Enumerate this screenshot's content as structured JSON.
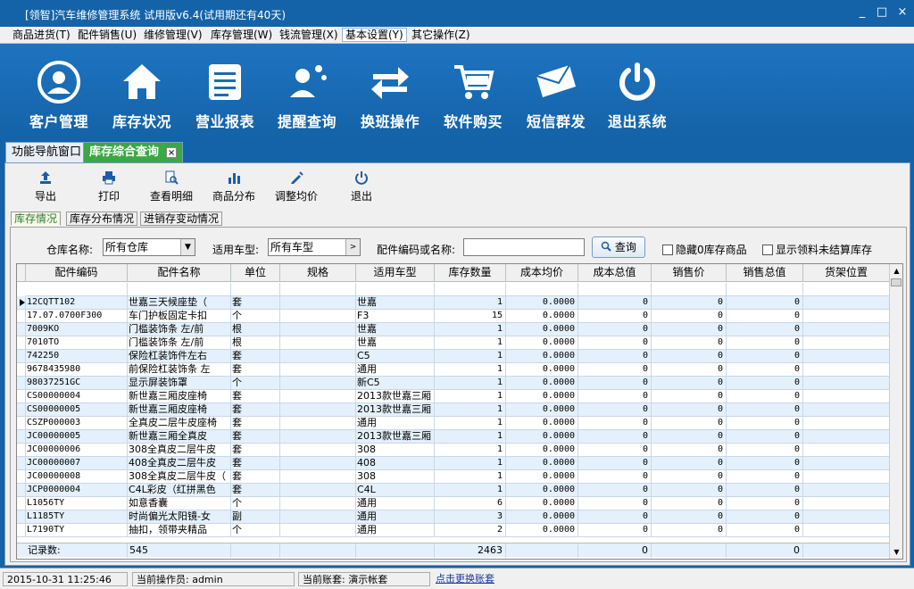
{
  "window": {
    "title": "[领智]汽车维修管理系统 试用版v6.4(试用期还有40天)",
    "controls": [
      "_",
      "□",
      "×"
    ]
  },
  "menu": [
    "商品进货(T)",
    "配件销售(U)",
    "维修管理(V)",
    "库存管理(W)",
    "钱流管理(X)",
    "基本设置(Y)",
    "其它操作(Z)"
  ],
  "big_toolbar": [
    {
      "label": "客户管理",
      "icon": "user-icon"
    },
    {
      "label": "库存状况",
      "icon": "home-icon"
    },
    {
      "label": "营业报表",
      "icon": "report-icon"
    },
    {
      "label": "提醒查询",
      "icon": "reminder-icon"
    },
    {
      "label": "换班操作",
      "icon": "switch-icon"
    },
    {
      "label": "软件购买",
      "icon": "cart-icon"
    },
    {
      "label": "短信群发",
      "icon": "envelope-icon"
    },
    {
      "label": "退出系统",
      "icon": "power-icon"
    }
  ],
  "tabs": {
    "nav": "功能导航窗口",
    "active": "库存综合查询",
    "close": "×"
  },
  "toolbar": {
    "export": "导出",
    "print": "打印",
    "detail": "查看明细",
    "distribution": "商品分布",
    "adjust": "调整均价",
    "exit": "退出"
  },
  "subtabs": [
    "库存情况",
    "库存分布情况",
    "进销存变动情况"
  ],
  "filters": {
    "warehouse_label": "仓库名称:",
    "warehouse_value": "所有仓库",
    "model_label": "适用车型:",
    "model_value": "所有车型",
    "model_btn": ">",
    "code_label": "配件编码或名称:",
    "code_value": "",
    "query_btn": "查询",
    "hide_zero": "隐藏0库存商品",
    "show_unsettled": "显示领料未结算库存"
  },
  "grid": {
    "columns": [
      "配件编码",
      "配件名称",
      "单位",
      "规格",
      "适用车型",
      "库存数量",
      "成本均价",
      "成本总值",
      "销售价",
      "销售总值",
      "货架位置"
    ],
    "rows": [
      [
        "12CQTT102",
        "世嘉三天候座垫（",
        "套",
        "",
        "世嘉",
        "1",
        "0.0000",
        "0",
        "0",
        "0",
        ""
      ],
      [
        "17.07.0700F300",
        "车门护板固定卡扣",
        "个",
        "",
        "F3",
        "15",
        "0.0000",
        "0",
        "0",
        "0",
        ""
      ],
      [
        "7009KO",
        "门槛装饰条 左/前",
        "根",
        "",
        "世嘉",
        "1",
        "0.0000",
        "0",
        "0",
        "0",
        ""
      ],
      [
        "7010TO",
        "门槛装饰条 左/前",
        "根",
        "",
        "世嘉",
        "1",
        "0.0000",
        "0",
        "0",
        "0",
        ""
      ],
      [
        "742250",
        "保险杠装饰件左右",
        "套",
        "",
        "C5",
        "1",
        "0.0000",
        "0",
        "0",
        "0",
        ""
      ],
      [
        "9678435980",
        "前保险杠装饰条 左",
        "套",
        "",
        "通用",
        "1",
        "0.0000",
        "0",
        "0",
        "0",
        ""
      ],
      [
        "98037251GC",
        "显示屏装饰罩",
        "个",
        "",
        "新C5",
        "1",
        "0.0000",
        "0",
        "0",
        "0",
        ""
      ],
      [
        "CS00000004",
        "新世嘉三厢皮座椅",
        "套",
        "",
        "2013款世嘉三厢",
        "1",
        "0.0000",
        "0",
        "0",
        "0",
        ""
      ],
      [
        "CS00000005",
        "新世嘉三厢皮座椅",
        "套",
        "",
        "2013款世嘉三厢",
        "1",
        "0.0000",
        "0",
        "0",
        "0",
        ""
      ],
      [
        "CSZP000003",
        "全真皮二层牛皮座椅",
        "套",
        "",
        "通用",
        "1",
        "0.0000",
        "0",
        "0",
        "0",
        ""
      ],
      [
        "JC00000005",
        "新世嘉三厢全真皮",
        "套",
        "",
        "2013款世嘉三厢",
        "1",
        "0.0000",
        "0",
        "0",
        "0",
        ""
      ],
      [
        "JC00000006",
        "308全真皮二层牛皮",
        "套",
        "",
        "308",
        "1",
        "0.0000",
        "0",
        "0",
        "0",
        ""
      ],
      [
        "JC00000007",
        "408全真皮二层牛皮",
        "套",
        "",
        "408",
        "1",
        "0.0000",
        "0",
        "0",
        "0",
        ""
      ],
      [
        "JC00000008",
        "308全真皮二层牛皮（",
        "套",
        "",
        "308",
        "1",
        "0.0000",
        "0",
        "0",
        "0",
        ""
      ],
      [
        "JCP0000004",
        "C4L彩皮（红拼黑色",
        "套",
        "",
        "C4L",
        "1",
        "0.0000",
        "0",
        "0",
        "0",
        ""
      ],
      [
        "L1056TY",
        "如意香囊",
        "个",
        "",
        "通用",
        "6",
        "0.0000",
        "0",
        "0",
        "0",
        ""
      ],
      [
        "L1185TY",
        "时尚偏光太阳镜-女",
        "副",
        "",
        "通用",
        "3",
        "0.0000",
        "0",
        "0",
        "0",
        ""
      ],
      [
        "L7190TY",
        "抽扣，领带夹精品",
        "个",
        "",
        "通用",
        "2",
        "0.0000",
        "0",
        "0",
        "0",
        ""
      ]
    ],
    "footer": {
      "label": "记录数:",
      "count": "545",
      "stock_total": "2463",
      "cost_total": "0",
      "sales_total": "0"
    }
  },
  "status": {
    "datetime": "2015-10-31 11:25:46",
    "operator": "当前操作员: admin",
    "account": "当前账套: 演示帐套",
    "switch_link": "点击更换账套"
  },
  "colors": {
    "brand_blue": "#1463a8",
    "active_tab": "#3aa844",
    "row_alt": "#e4f0fb"
  }
}
